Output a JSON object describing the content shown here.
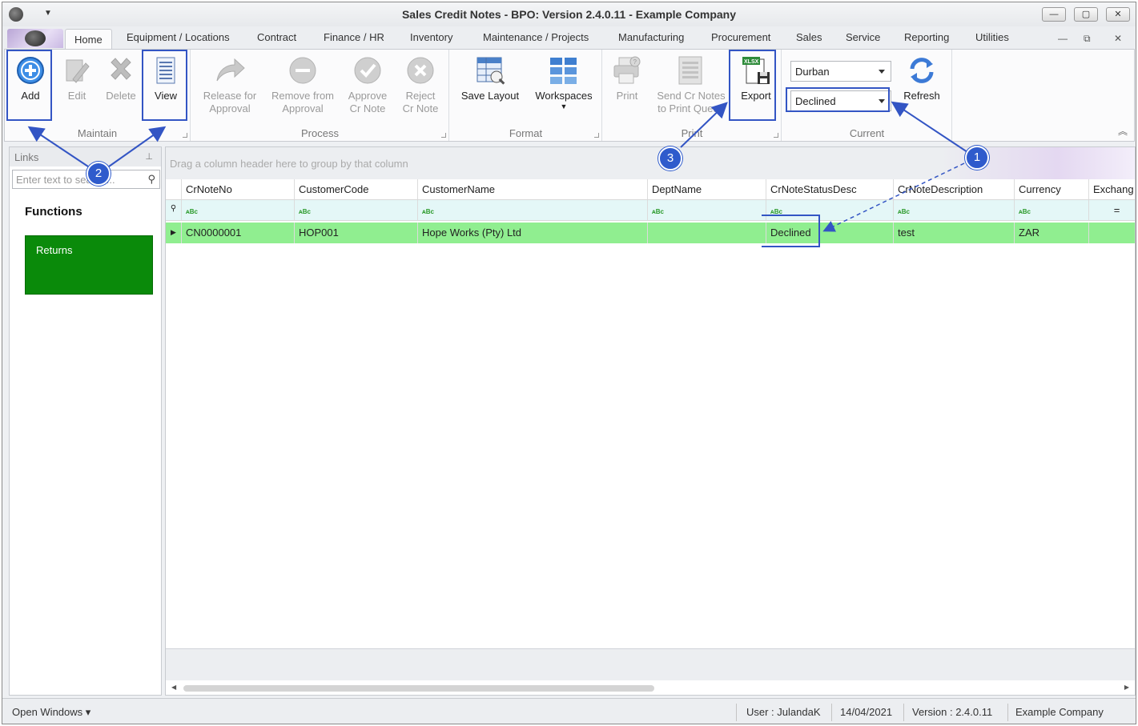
{
  "window": {
    "title": "Sales Credit Notes - BPO: Version 2.4.0.11 - Example Company",
    "controls": {
      "minimize": "—",
      "maximize": "▢",
      "close": "✕"
    }
  },
  "tabs": [
    "Home",
    "Equipment / Locations",
    "Contract",
    "Finance / HR",
    "Inventory",
    "Maintenance / Projects",
    "Manufacturing",
    "Procurement",
    "Sales",
    "Service",
    "Reporting",
    "Utilities"
  ],
  "mdi_controls": {
    "minimize": "—",
    "restore": "⧉",
    "close": "✕"
  },
  "ribbon": {
    "maintain": {
      "label": "Maintain",
      "add": "Add",
      "edit": "Edit",
      "delete": "Delete",
      "view": "View"
    },
    "process": {
      "label": "Process",
      "release_line1": "Release for",
      "release_line2": "Approval",
      "remove_line1": "Remove from",
      "remove_line2": "Approval",
      "approve_line1": "Approve",
      "approve_line2": "Cr Note",
      "reject_line1": "Reject",
      "reject_line2": "Cr Note"
    },
    "format": {
      "label": "Format",
      "save_layout": "Save Layout",
      "workspaces": "Workspaces"
    },
    "print": {
      "label": "Print",
      "print": "Print",
      "send_line1": "Send Cr Notes",
      "send_line2": "to Print Queue",
      "export": "Export",
      "export_badge": "XLSX"
    },
    "current": {
      "label": "Current",
      "site": "Durban",
      "status": "Declined",
      "refresh": "Refresh"
    }
  },
  "links": {
    "header": "Links",
    "search_placeholder": "Enter text to search...",
    "functions_title": "Functions",
    "tiles": [
      "Returns"
    ]
  },
  "grid": {
    "group_panel_text": "Drag a column header here to group by that column",
    "columns": [
      "CrNoteNo",
      "CustomerCode",
      "CustomerName",
      "DeptName",
      "CrNoteStatusDesc",
      "CrNoteDescription",
      "Currency",
      "Exchang"
    ],
    "filter_icon": "ᴀBc",
    "exchange_filter": "=",
    "rows": [
      {
        "CrNoteNo": "CN0000001",
        "CustomerCode": "HOP001",
        "CustomerName": "Hope Works (Pty) Ltd",
        "DeptName": "",
        "CrNoteStatusDesc": "Declined",
        "CrNoteDescription": "test",
        "Currency": "ZAR",
        "Exchang": ""
      }
    ],
    "row_color": "#90ee90"
  },
  "statusbar": {
    "open_windows": "Open Windows ▾",
    "user": "User : JulandaK",
    "date": "14/04/2021",
    "version": "Version : 2.4.0.11",
    "company": "Example Company"
  },
  "annotations": {
    "badge1": "1",
    "badge2": "2",
    "badge3": "3",
    "color": "#3355c4"
  }
}
